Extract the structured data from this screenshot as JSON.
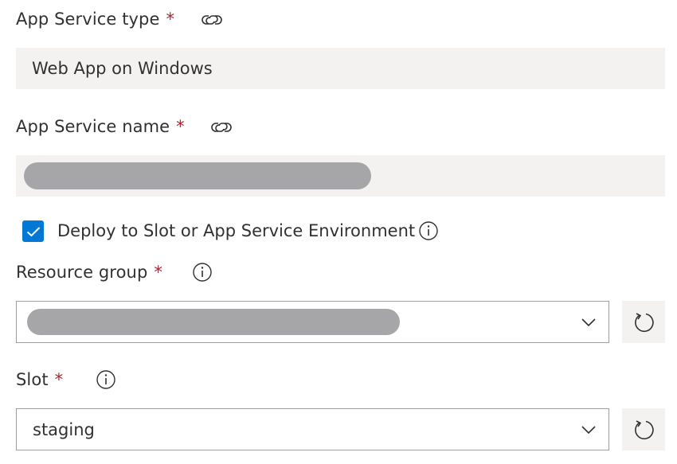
{
  "app_service_type": {
    "label": "App Service type",
    "required_mark": "*",
    "value": "Web App on Windows",
    "icon": "link-icon"
  },
  "app_service_name": {
    "label": "App Service name",
    "required_mark": "*",
    "value": "",
    "icon": "link-icon",
    "redacted": true
  },
  "deploy_to_slot": {
    "label": "Deploy to Slot or App Service Environment",
    "checked": true,
    "icon": "info-icon"
  },
  "resource_group": {
    "label": "Resource group",
    "required_mark": "*",
    "value": "",
    "redacted": true,
    "icon": "info-icon",
    "refresh_icon": "refresh-icon",
    "chevron_icon": "chevron-down-icon"
  },
  "slot": {
    "label": "Slot",
    "required_mark": "*",
    "value": "staging",
    "icon": "info-icon",
    "refresh_icon": "refresh-icon",
    "chevron_icon": "chevron-down-icon"
  },
  "colors": {
    "accent": "#0078d4",
    "required": "#a4262c",
    "field_bg": "#f3f2f1",
    "border": "#a19f9d",
    "redaction": "#a6a6a8"
  }
}
